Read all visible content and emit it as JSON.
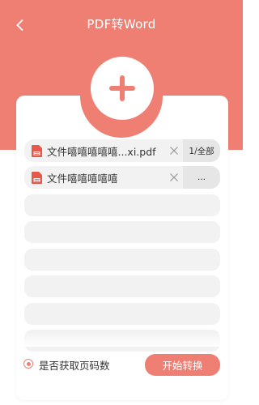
{
  "header": {
    "title": "PDF转Word",
    "back_icon": "chevron-left-icon",
    "background_color": "#ef7f73"
  },
  "add_button": {
    "icon": "plus-icon",
    "color": "#ef7f73"
  },
  "files": [
    {
      "name": "文件嘻嘻嘻嘻嘻...xi.pdf",
      "pages_label": "1/全部",
      "remove_icon": "close-icon",
      "file_icon": "pdf-file-icon"
    },
    {
      "name": "文件嘻嘻嘻嘻嘻",
      "pages_label": "...",
      "remove_icon": "close-icon",
      "file_icon": "pdf-file-icon"
    }
  ],
  "empty_slot_count": 6,
  "options": {
    "get_page_count_label": "是否获取页码数",
    "get_page_count_selected": true
  },
  "actions": {
    "convert_label": "开始转换"
  },
  "colors": {
    "accent": "#ef7f73",
    "row_background": "#f2f2f2"
  }
}
